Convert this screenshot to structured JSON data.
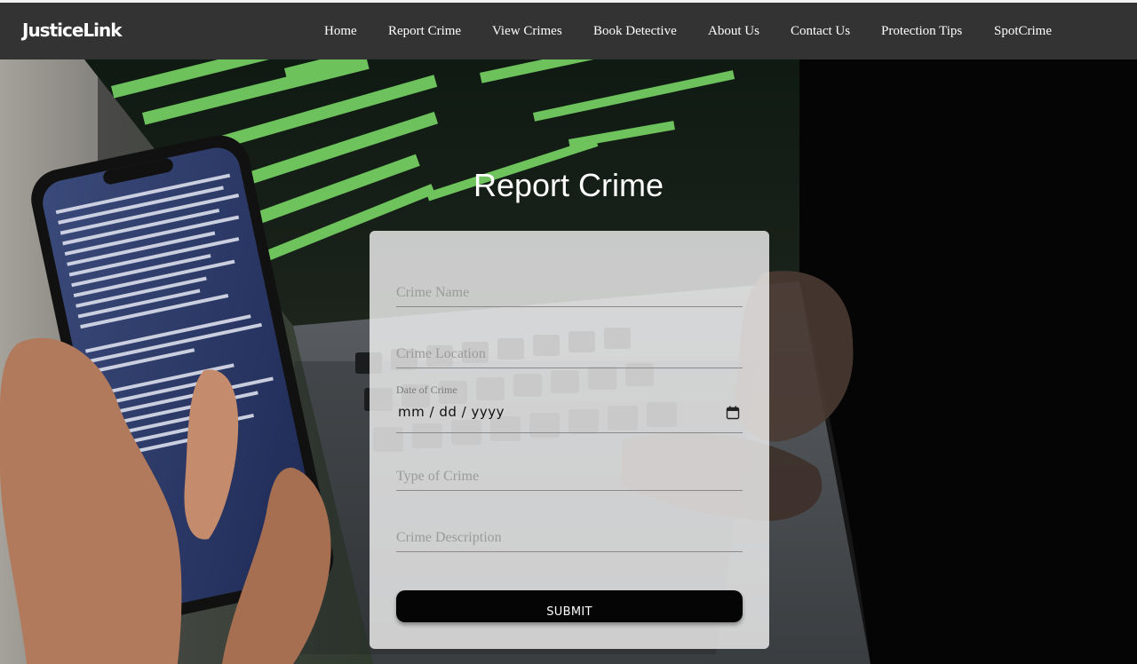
{
  "brand": {
    "name": "JusticeLink"
  },
  "nav": {
    "items": [
      {
        "label": "Home"
      },
      {
        "label": "Report Crime"
      },
      {
        "label": "View Crimes"
      },
      {
        "label": "Book Detective"
      },
      {
        "label": "About Us"
      },
      {
        "label": "Contact Us"
      },
      {
        "label": "Protection Tips"
      },
      {
        "label": "SpotCrime"
      }
    ]
  },
  "page": {
    "title": "Report Crime"
  },
  "form": {
    "crime_name": {
      "placeholder": "Crime Name",
      "value": ""
    },
    "crime_location": {
      "placeholder": "Crime Location",
      "value": ""
    },
    "date_of_crime": {
      "label": "Date of Crime",
      "value": "mm / dd / yyyy",
      "icon": "calendar-icon"
    },
    "type_of_crime": {
      "placeholder": "Type of Crime",
      "value": ""
    },
    "crime_description": {
      "placeholder": "Crime Description",
      "value": ""
    },
    "submit_label": "SUBMIT"
  },
  "colors": {
    "navbar_bg": "#333333",
    "card_bg": "rgba(245,245,245,0.80)",
    "button_bg": "#050505",
    "terminal_green": "#7fe06a"
  }
}
